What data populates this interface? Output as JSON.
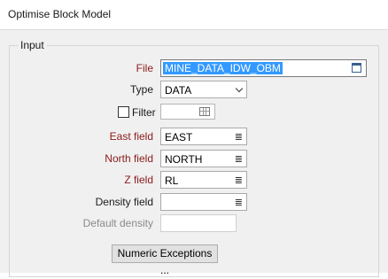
{
  "window": {
    "title": "Optimise Block Model"
  },
  "group": {
    "legend": "Input"
  },
  "file": {
    "label": "File",
    "value": "MINE_DATA_IDW_OBM",
    "icon": "file-browse-icon"
  },
  "type": {
    "label": "Type",
    "selected": "DATA",
    "icon": "chevron-down-icon"
  },
  "filter": {
    "label": "Filter",
    "checked": false,
    "value": "",
    "icon": "table-grid-icon"
  },
  "east_field": {
    "label": "East field",
    "value": "EAST",
    "icon": "field-list-icon"
  },
  "north_field": {
    "label": "North field",
    "value": "NORTH",
    "icon": "field-list-icon"
  },
  "z_field": {
    "label": "Z field",
    "value": "RL",
    "icon": "field-list-icon"
  },
  "density_field": {
    "label": "Density field",
    "value": "",
    "icon": "field-list-icon"
  },
  "default_density": {
    "label": "Default density",
    "value": ""
  },
  "numeric_exceptions": {
    "label": "Numeric Exceptions ..."
  },
  "colors": {
    "required_label": "#8b1a1a",
    "disabled_label": "#8a8a8a",
    "selection": "#3399ff"
  }
}
